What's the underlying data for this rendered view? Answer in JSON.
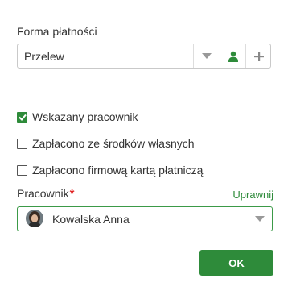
{
  "payment": {
    "label": "Forma płatności",
    "value": "Przelew",
    "dropdown_icon": "chevron-down-icon",
    "person_icon": "person-icon",
    "add_icon": "plus-icon"
  },
  "checkboxes": [
    {
      "label": "Wskazany pracownik",
      "checked": true
    },
    {
      "label": "Zapłacono ze środków własnych",
      "checked": false
    },
    {
      "label": "Zapłacono firmową kartą płatniczą",
      "checked": false
    }
  ],
  "employee": {
    "label": "Pracownik",
    "required_mark": "*",
    "link": "Uprawnij",
    "value": "Kowalska Anna"
  },
  "actions": {
    "ok_label": "OK"
  },
  "colors": {
    "accent": "#2e8b3a",
    "required": "#e02020",
    "border": "#c9c9c9"
  }
}
